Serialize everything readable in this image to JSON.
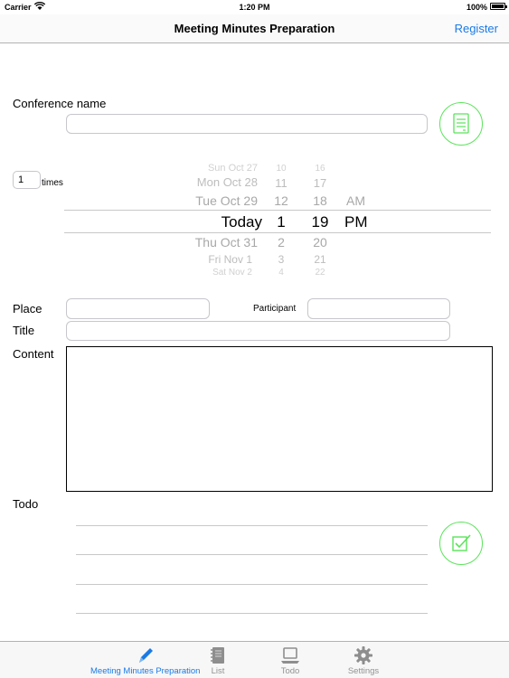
{
  "status": {
    "carrier": "Carrier",
    "time": "1:20 PM",
    "battery": "100%"
  },
  "nav": {
    "title": "Meeting Minutes Preparation",
    "register": "Register"
  },
  "form": {
    "conference_label": "Conference name",
    "conference_value": "",
    "times_value": "1",
    "times_label": "times",
    "place_label": "Place",
    "place_value": "",
    "participant_label": "Participant",
    "participant_value": "",
    "title_label": "Title",
    "title_value": "",
    "content_label": "Content",
    "content_value": "",
    "todo_label": "Todo"
  },
  "picker": {
    "dates": [
      "Sun Oct 27",
      "Mon Oct 28",
      "Tue Oct 29",
      "Today",
      "Thu Oct 31",
      "Fri Nov 1",
      "Sat Nov 2"
    ],
    "hours": [
      "10",
      "11",
      "12",
      "1",
      "2",
      "3",
      "4"
    ],
    "minutes": [
      "16",
      "17",
      "18",
      "19",
      "20",
      "21",
      "22"
    ],
    "ampm": [
      "AM",
      "PM"
    ]
  },
  "tabs": [
    {
      "label": "Meeting Minutes Preparation",
      "icon": "pen-icon",
      "active": true
    },
    {
      "label": "List",
      "icon": "notebook-icon",
      "active": false
    },
    {
      "label": "Todo",
      "icon": "laptop-icon",
      "active": false
    },
    {
      "label": "Settings",
      "icon": "gear-icon",
      "active": false
    }
  ],
  "colors": {
    "accent": "#1a7ae6",
    "green": "#5be35b",
    "tab_inactive": "#929292"
  }
}
